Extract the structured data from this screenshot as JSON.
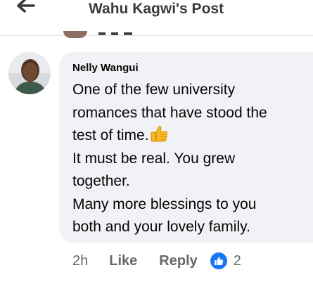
{
  "header": {
    "title": "Wahu Kagwi's Post",
    "back_icon": "back-arrow-icon"
  },
  "comment": {
    "author": "Nelly Wangui",
    "lines": [
      "One of the few university",
      "romances that have stood the",
      "test of time.",
      "It must be real. You grew",
      "together.",
      "Many more blessings to you",
      "both and your lovely family."
    ],
    "emoji": "thumbs-up-emoji",
    "time": "2h",
    "like_label": "Like",
    "reply_label": "Reply",
    "reaction_type": "like-reaction-icon",
    "reaction_count": "2"
  },
  "colors": {
    "bubble": "#f0f2f5",
    "muted_text": "#65676b",
    "like_blue": "#1877f2",
    "header_text": "#3a3b3c"
  }
}
